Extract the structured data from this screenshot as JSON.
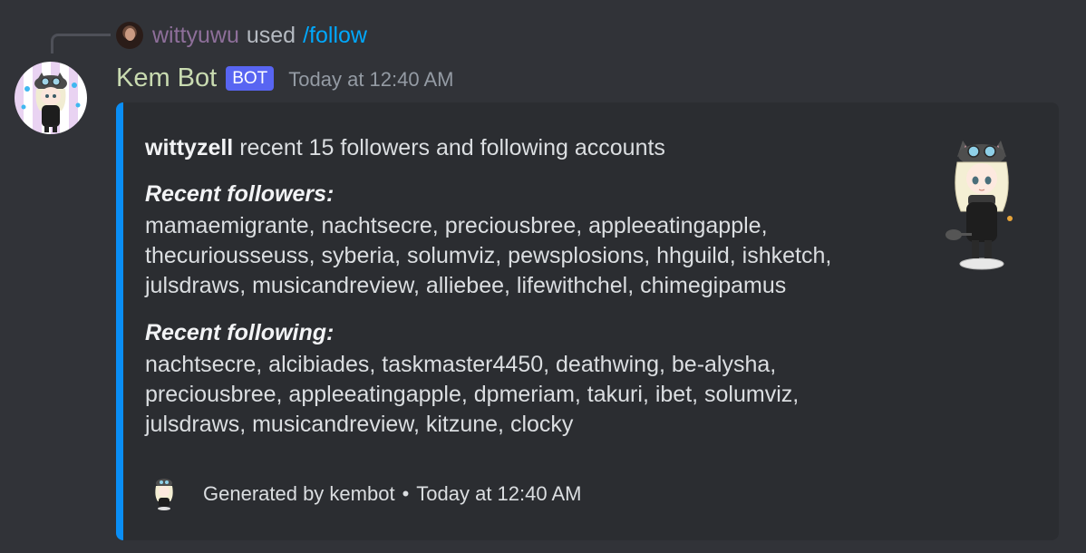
{
  "reply": {
    "username": "wittyuwu",
    "used_text": "used",
    "command": "/follow",
    "username_color": "#8e6f9a",
    "command_color": "#00a8fc"
  },
  "message": {
    "author": "Kem Bot",
    "author_color": "#c9dbb1",
    "bot_tag": "BOT",
    "timestamp": "Today at 12:40 AM"
  },
  "embed": {
    "accent_color": "#0a8ef5",
    "title_user": "wittyzell",
    "title_rest": "recent 15 followers and following accounts",
    "followers_heading": "Recent followers:",
    "followers_lines": [
      "mamaemigrante, nachtsecre, preciousbree, appleeatingapple,",
      "thecuriousseuss, syberia, solumviz, pewsplosions, hhguild, ishketch,",
      "julsdraws, musicandreview, alliebee, lifewithchel, chimegipamus"
    ],
    "following_heading": "Recent following:",
    "following_lines": [
      "nachtsecre, alcibiades, taskmaster4450, deathwing, be-alysha,",
      "preciousbree, appleeatingapple, dpmeriam, takuri, ibet, solumviz,",
      "julsdraws, musicandreview, kitzune, clocky"
    ],
    "footer_text": "Generated by kembot",
    "footer_separator": "•",
    "footer_timestamp": "Today at 12:40 AM"
  },
  "icons": {
    "reply_avatar": "user-avatar-icon",
    "bot_avatar": "kem-bot-avatar-icon",
    "thumbnail": "chibi-character-thumbnail",
    "footer_icon": "kembot-footer-icon"
  }
}
